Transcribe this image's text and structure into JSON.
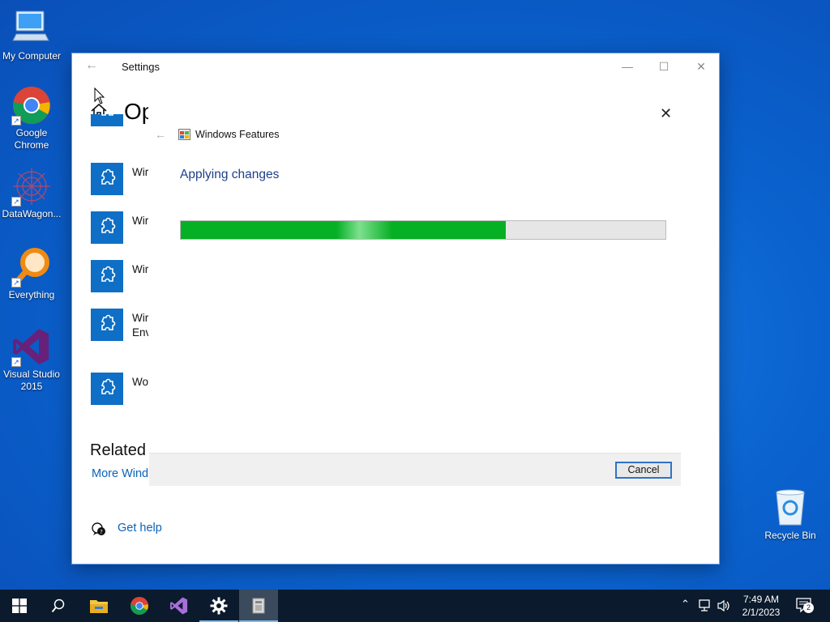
{
  "desktop": {
    "icons": [
      {
        "label": "My Computer"
      },
      {
        "label": "Google Chrome"
      },
      {
        "label": "DataWagon..."
      },
      {
        "label": "Everything"
      },
      {
        "label": "Visual Studio 2015"
      },
      {
        "label": "Recycle Bin"
      }
    ]
  },
  "settings": {
    "window_title": "Settings",
    "page_title": "Optional features",
    "features": [
      {
        "label": "Wir"
      },
      {
        "label": "Wir"
      },
      {
        "label": "Wir"
      },
      {
        "label": "Wir\nEnv"
      },
      {
        "label": "Wo"
      }
    ],
    "related_heading": "Related",
    "more_link": "More Wind",
    "help_link": "Get help"
  },
  "dialog": {
    "title": "Windows Features",
    "heading": "Applying changes",
    "progress_fraction": 0.67,
    "cancel_label": "Cancel"
  },
  "taskbar": {
    "time": "7:49 AM",
    "date": "2/1/2023",
    "notification_count": "2"
  }
}
